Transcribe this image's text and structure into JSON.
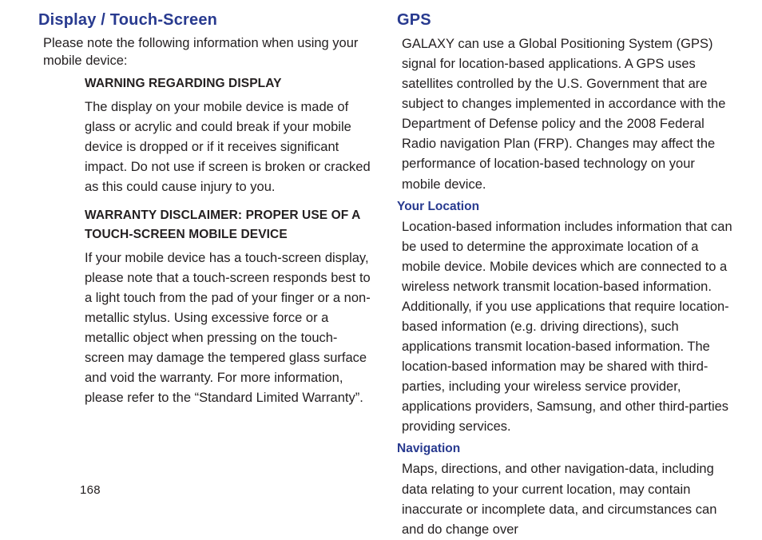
{
  "page_number": "168",
  "left": {
    "heading": "Display / Touch-Screen",
    "intro": "Please note the following information when using your mobile device:",
    "warn1_title": "WARNING REGARDING DISPLAY",
    "warn1_body": "The display on your mobile device is made of glass or acrylic and could break if your mobile device is dropped or if it receives significant impact. Do not use if screen is broken or cracked as this could cause injury to you.",
    "warn2_title_l1": "WARRANTY DISCLAIMER: PROPER USE OF A",
    "warn2_title_l2": "TOUCH-SCREEN MOBILE DEVICE",
    "warn2_body": "If your mobile device has a touch-screen display, please note that a touch-screen responds best to a light touch from the pad of your finger or a non-metallic stylus. Using excessive force or a metallic object when pressing on the touch-screen may damage the tempered glass surface and void the warranty. For more information, please refer to the “Standard Limited Warranty”."
  },
  "right": {
    "heading": "GPS",
    "intro": "GALAXY can use a Global Positioning System (GPS) signal for location-based applications. A GPS uses satellites controlled by the U.S. Government that are subject to changes implemented in accordance with the Department of Defense policy and the 2008 Federal Radio navigation Plan (FRP). Changes may affect the performance of location-based technology on your mobile device.",
    "loc_heading": "Your Location",
    "loc_body": "Location-based information includes information that can be used to determine the approximate location of a mobile device. Mobile devices which are connected to a wireless network transmit location-based information. Additionally, if you use applications that require location-based information (e.g. driving directions), such applications transmit location-based information. The location-based information may be shared with third-parties, including your wireless service provider, applications providers, Samsung, and other third-parties providing services.",
    "nav_heading": "Navigation",
    "nav_body": "Maps, directions, and other navigation-data, including data relating to your current location, may contain inaccurate or incomplete data, and circumstances can and do change over"
  }
}
